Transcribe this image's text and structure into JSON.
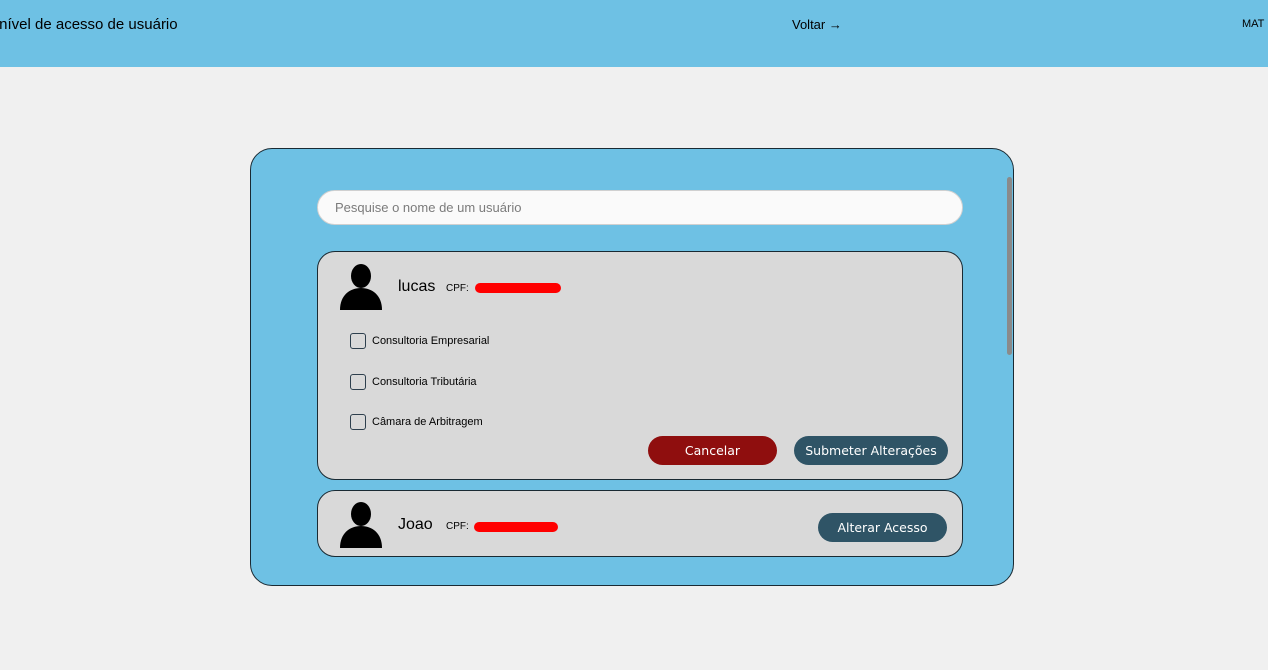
{
  "header": {
    "title": "r nível de acesso de usuário",
    "back_label": "Voltar →",
    "user_label": "MAT"
  },
  "search": {
    "placeholder": "Pesquise o nome de um usuário",
    "value": ""
  },
  "users": [
    {
      "name": "lucas",
      "cpf_label": "CPF:",
      "expanded": true,
      "options": [
        {
          "label": "Consultoria Empresarial",
          "checked": false
        },
        {
          "label": "Consultoria Tributária",
          "checked": false
        },
        {
          "label": "Câmara de Arbitragem",
          "checked": false
        }
      ],
      "cancel_label": "Cancelar",
      "submit_label": "Submeter Alterações"
    },
    {
      "name": "Joao",
      "cpf_label": "CPF:",
      "expanded": false,
      "alter_label": "Alterar Acesso"
    }
  ],
  "colors": {
    "header_bg": "#6ec1e4",
    "panel_bg": "#6ec1e4",
    "card_bg": "#d9d9d9",
    "cancel_button": "#8f0e0e",
    "primary_button": "#2f5466",
    "redaction": "#ff0000"
  },
  "icons": {
    "avatar": "user-silhouette-icon"
  }
}
